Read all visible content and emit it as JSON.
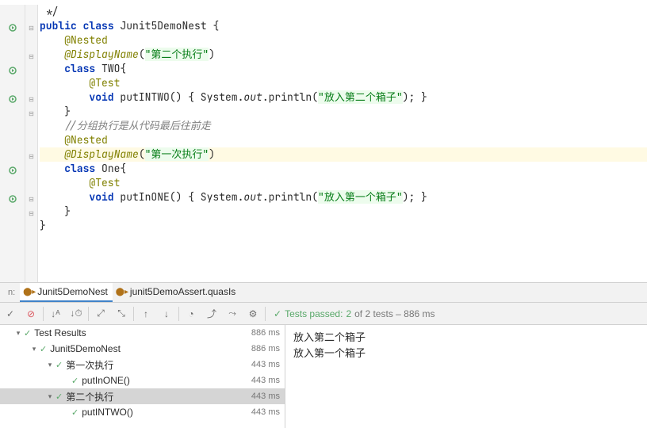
{
  "code": {
    "lines": [
      {
        "h": "",
        "t": " */"
      },
      {
        "h": "run",
        "fold": "⊟",
        "t_html": "<span class='kw'>public</span> <span class='kw'>class</span> Junit5DemoNest {"
      },
      {
        "h": "",
        "t_html": "    <span class='ann'>@Nested</span>"
      },
      {
        "h": "",
        "fold": "⊟",
        "t_html": "    <span class='ann-italic'>@DisplayName</span>(<span class='str str-bg'>\"第二个执行\"</span>)"
      },
      {
        "h": "run",
        "t_html": "    <span class='kw'>class</span> TWO{"
      },
      {
        "h": "",
        "t_html": "        <span class='ann'>@Test</span>"
      },
      {
        "h": "run",
        "fold": "⊟",
        "t_html": "        <span class='kw'>void</span> putINTWO() { System.<span class='it'>out</span>.println(<span class='str str-bg'>\"放入第二个箱子\"</span>); }"
      },
      {
        "h": "",
        "fold": "⊟",
        "t": "    }"
      },
      {
        "h": "",
        "t_html": "    <span class='cm'>//分组执行是从代码最后往前走</span>"
      },
      {
        "h": "",
        "t_html": "    <span class='ann'>@Nested</span>"
      },
      {
        "h": "",
        "hl": true,
        "fold": "⊟",
        "t_html": "    <span class='ann-italic'>@DisplayName</span>(<span class='str str-bg'>\"第一次执行\"</span>)"
      },
      {
        "h": "run",
        "t_html": "    <span class='kw'>class</span> One{"
      },
      {
        "h": "",
        "t_html": "        <span class='ann'>@Test</span>"
      },
      {
        "h": "run",
        "fold": "⊟",
        "t_html": "        <span class='kw'>void</span> putInONE() { System.<span class='it'>out</span>.println(<span class='str str-bg'>\"放入第一个箱子\"</span>); }"
      },
      {
        "h": "",
        "fold": "⊟",
        "t": "    }"
      },
      {
        "h": "",
        "t": "}"
      }
    ]
  },
  "tabs": {
    "run_label_prefix": "n:",
    "items": [
      {
        "label": "Junit5DemoNest",
        "active": true
      },
      {
        "label": "junit5DemoAssert.quasIs",
        "active": false
      }
    ]
  },
  "toolbar": {
    "status_prefix": "Tests passed:",
    "passed": "2",
    "of_text": "of 2 tests – 886 ms"
  },
  "tree": [
    {
      "indent": 0,
      "chev": "▾",
      "label": "Test Results",
      "time": "886 ms"
    },
    {
      "indent": 1,
      "chev": "▾",
      "label": "Junit5DemoNest",
      "time": "886 ms"
    },
    {
      "indent": 2,
      "chev": "▾",
      "label": "第一次执行",
      "time": "443 ms"
    },
    {
      "indent": 3,
      "chev": "",
      "label": "putInONE()",
      "time": "443 ms"
    },
    {
      "indent": 2,
      "chev": "▾",
      "label": "第二个执行",
      "time": "443 ms",
      "sel": true
    },
    {
      "indent": 3,
      "chev": "",
      "label": "putINTWO()",
      "time": "443 ms"
    }
  ],
  "console": [
    "放入第二个箱子",
    "放入第一个箱子"
  ]
}
